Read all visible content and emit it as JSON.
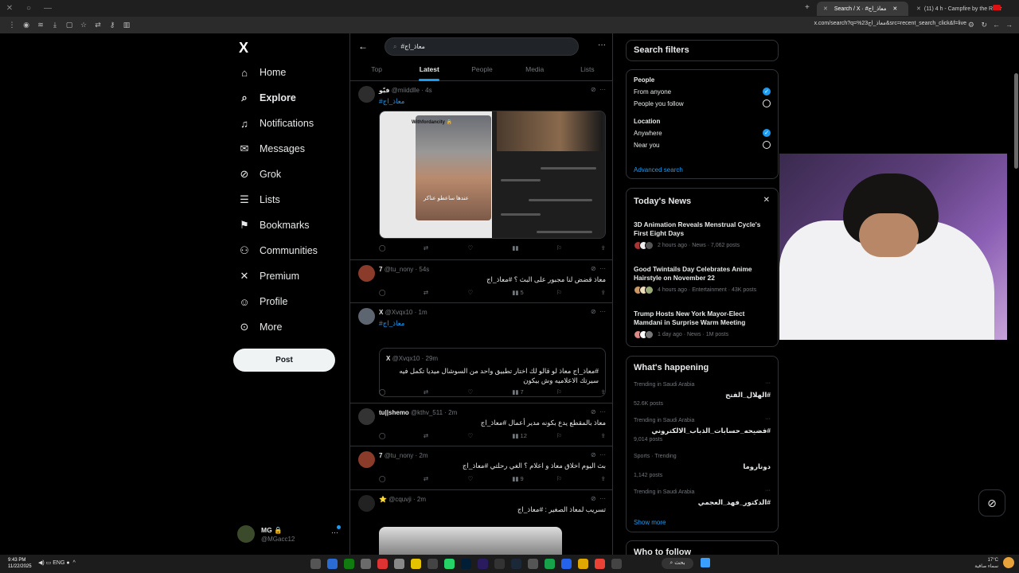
{
  "browser": {
    "tabs": [
      {
        "label": "Search / X · #معاذ_اج",
        "active": true
      },
      {
        "label": "(11) 4 h - Campfire by the River",
        "active": false
      }
    ],
    "url": "x.com/search?q=%23معاذ_اج&src=recent_search_click&f=live"
  },
  "nav": {
    "logo": "X",
    "items": [
      {
        "label": "Home",
        "icon": "home-icon",
        "glyph": "⌂"
      },
      {
        "label": "Explore",
        "icon": "search-icon",
        "glyph": "⌕"
      },
      {
        "label": "Notifications",
        "icon": "bell-icon",
        "glyph": "♪"
      },
      {
        "label": "Messages",
        "icon": "mail-icon",
        "glyph": "✉"
      },
      {
        "label": "Grok",
        "icon": "grok-icon",
        "glyph": "⊘"
      },
      {
        "label": "Lists",
        "icon": "list-icon",
        "glyph": "☰"
      },
      {
        "label": "Bookmarks",
        "icon": "bookmark-icon",
        "glyph": "⚑"
      },
      {
        "label": "Communities",
        "icon": "communities-icon",
        "glyph": "⚇"
      },
      {
        "label": "Premium",
        "icon": "x-icon",
        "glyph": "✕"
      },
      {
        "label": "Profile",
        "icon": "user-icon",
        "glyph": "☺"
      },
      {
        "label": "More",
        "icon": "more-circle-icon",
        "glyph": "⊙"
      }
    ],
    "post_label": "Post",
    "account": {
      "name": "MG 🔒",
      "handle": "@MGacc12"
    }
  },
  "search": {
    "query": "#معاذ_اج",
    "tabs": [
      "Top",
      "Latest",
      "People",
      "Media",
      "Lists"
    ],
    "active_tab": "Latest"
  },
  "tweets": [
    {
      "name": "فيّو",
      "handle": "@miiddlle · 4s",
      "text": "#معاذ_اج",
      "media_caption": "Withfordancity 🔒",
      "media_overlay": "عندها ساعطو عناكر",
      "counts": {
        "reply": "",
        "retweet": "",
        "like": "",
        "views": ""
      }
    },
    {
      "name": "7",
      "handle": "@tu_nony · 54s",
      "text": "معاذ قضض لنا مجبور على البث ؟ #معاذ_اج",
      "counts": {
        "views": "5"
      }
    },
    {
      "name": "X",
      "handle": "@Xvqx10 · 1m",
      "text": "#معاذ_اج",
      "quote": {
        "name": "X",
        "handle": "@Xvqx10 · 29m",
        "text": "#معاذ_اج معاذ لو قالو لك اختار تطبيق واحد من السوشال ميديا تكمل فيه سيرتك الاعلاميه وش بيكون"
      },
      "counts": {
        "views": "7"
      }
    },
    {
      "name": "tu||shemo",
      "handle": "@kthv_511 · 2m",
      "text": "معاذ بالمقطع يدع بكونه مدير أعمال #معاذ_اج",
      "counts": {
        "views": "12"
      }
    },
    {
      "name": "7",
      "handle": "@tu_nony · 2m",
      "text": "بث اليوم اخلاق معاذ و اعلام ؟ الغي رحلتي #معاذ_اج",
      "counts": {
        "views": "9"
      }
    },
    {
      "name": "⭐",
      "handle": "@cquvji · 2m",
      "text": "تسريب لمعاذ الصغير : #معاذ_اج",
      "counts": {}
    }
  ],
  "filters": {
    "title": "Search filters",
    "people_label": "People",
    "people_options": [
      "From anyone",
      "People you follow"
    ],
    "location_label": "Location",
    "location_options": [
      "Anywhere",
      "Near you"
    ],
    "advanced": "Advanced search"
  },
  "news": {
    "title": "Today's News",
    "items": [
      {
        "title": "3D Animation Reveals Menstrual Cycle's First Eight Days",
        "meta": "2 hours ago · News · 7,062 posts"
      },
      {
        "title": "Good Twintails Day Celebrates Anime Hairstyle on November 22",
        "meta": "4 hours ago · Entertainment · 43K posts"
      },
      {
        "title": "Trump Hosts New York Mayor-Elect Mamdani in Surprise Warm Meeting",
        "meta": "1 day ago · News · 1M posts"
      }
    ]
  },
  "happening": {
    "title": "What's happening",
    "items": [
      {
        "context": "Trending in Saudi Arabia",
        "name": "#الهلال_الفتح",
        "count": "52.6K posts"
      },
      {
        "context": "Trending in Saudi Arabia",
        "name": "#فضيحه_حسابات_الذباب_الالكتروني",
        "count": "9,014 posts"
      },
      {
        "context": "Sports · Trending",
        "name": "دوناروما",
        "count": "1,142 posts"
      },
      {
        "context": "Trending in Saudi Arabia",
        "name": "#الدكتور_فهد_العجمي",
        "count": ""
      }
    ],
    "show_more": "Show more",
    "who_to_follow": "Who to follow"
  },
  "taskbar": {
    "time": "9:43 PM",
    "date": "11/22/2025",
    "lang": "ENG",
    "search": "بحث",
    "temp": "17°C",
    "weather": "سماء صافية"
  },
  "colors": {
    "accent": "#1d9bf0",
    "bg": "#000000",
    "border": "#2f3336",
    "muted": "#71767b"
  }
}
